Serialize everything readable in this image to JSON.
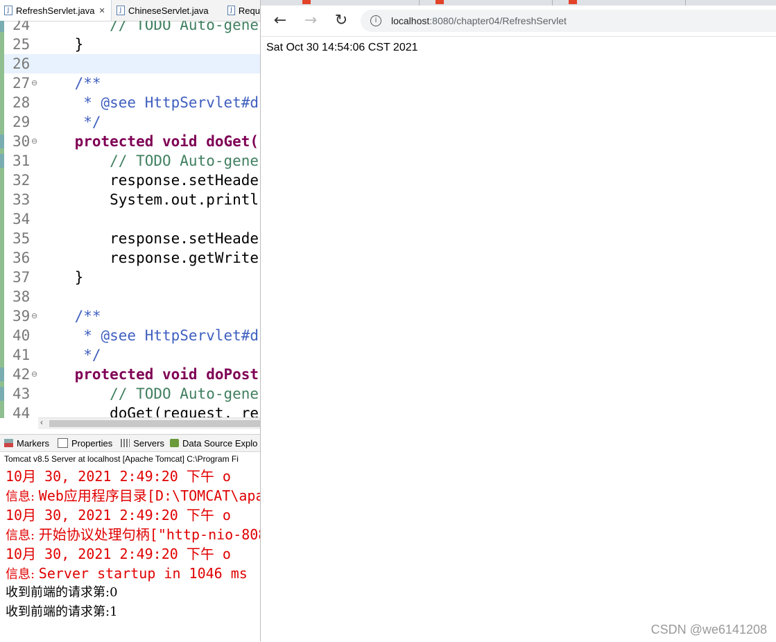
{
  "editor": {
    "tabs": [
      {
        "label": "RefreshServlet.java",
        "close": "✕"
      },
      {
        "label": "ChineseServlet.java"
      },
      {
        "label": "Requ"
      }
    ],
    "lines": [
      {
        "num": "24",
        "code": "        // TODO Auto-gene"
      },
      {
        "num": "25",
        "code": "    }"
      },
      {
        "num": "26",
        "code": ""
      },
      {
        "num": "27",
        "code": "    /**"
      },
      {
        "num": "28",
        "code": "     * @see HttpServlet#d"
      },
      {
        "num": "29",
        "code": "     */"
      },
      {
        "num": "30",
        "code": "    protected void doGet("
      },
      {
        "num": "31",
        "code": "        // TODO Auto-gene"
      },
      {
        "num": "32",
        "code": "        response.setHeade"
      },
      {
        "num": "33",
        "code": "        System.out.printl"
      },
      {
        "num": "34",
        "code": ""
      },
      {
        "num": "35",
        "code": "        response.setHeade"
      },
      {
        "num": "36",
        "code": "        response.getWrite"
      },
      {
        "num": "37",
        "code": "    }"
      },
      {
        "num": "38",
        "code": ""
      },
      {
        "num": "39",
        "code": "    /**"
      },
      {
        "num": "40",
        "code": "     * @see HttpServlet#d"
      },
      {
        "num": "41",
        "code": "     */"
      },
      {
        "num": "42",
        "code": "    protected void doPost"
      },
      {
        "num": "43",
        "code": "        // TODO Auto-gene"
      },
      {
        "num": "44",
        "code": "        doGet(request, re"
      }
    ],
    "scroll_left_icon": "‹"
  },
  "console": {
    "tabs": [
      {
        "label": "Markers",
        "icon": "markers-icon"
      },
      {
        "label": "Properties",
        "icon": "properties-icon"
      },
      {
        "label": "Servers",
        "icon": "servers-icon"
      },
      {
        "label": "Data Source Explo",
        "icon": "data-source-icon"
      }
    ],
    "header": "Tomcat v8.5 Server at localhost [Apache Tomcat] C:\\Program Fi",
    "lines": [
      {
        "text": "10月 30, 2021 2:49:20 下午 o"
      },
      {
        "prefix": "信息: ",
        "text": "Web应用程序目录[D:\\TOMCAT\\apa"
      },
      {
        "text": "10月 30, 2021 2:49:20 下午 o"
      },
      {
        "prefix": "信息: ",
        "text": "开始协议处理句柄[\"http-nio-808"
      },
      {
        "text": "10月 30, 2021 2:49:20 下午 o"
      },
      {
        "prefix": "信息: ",
        "text": "Server startup in 1046 ms"
      },
      {
        "text": "收到前端的请求第:0"
      },
      {
        "text": "收到前端的请求第:1"
      }
    ]
  },
  "browser": {
    "url_host": "localhost",
    "url_path": ":8080/chapter04/RefreshServlet",
    "back_icon": "←",
    "forward_icon": "→",
    "reload_icon": "↻",
    "info_icon": "i",
    "page_text": "Sat Oct 30 14:54:06 CST 2021"
  },
  "watermark": "CSDN @we6141208"
}
